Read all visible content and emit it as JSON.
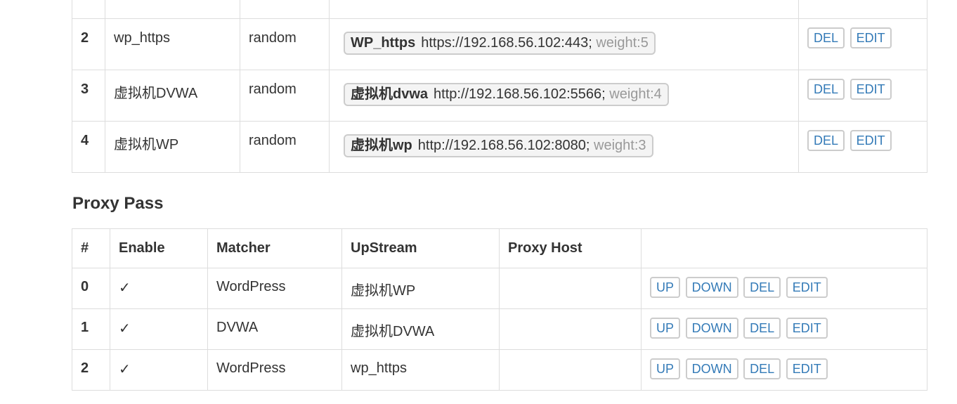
{
  "upstream": {
    "rows": [
      {
        "num": "2",
        "name": "wp_https",
        "algo": "random",
        "server": {
          "name": "WP_https",
          "url": "https://192.168.56.102:443;",
          "weight": "weight:5"
        }
      },
      {
        "num": "3",
        "name": "虚拟机DVWA",
        "algo": "random",
        "server": {
          "name": "虚拟机dvwa",
          "url": "http://192.168.56.102:5566;",
          "weight": "weight:4"
        }
      },
      {
        "num": "4",
        "name": "虚拟机WP",
        "algo": "random",
        "server": {
          "name": "虚拟机wp",
          "url": "http://192.168.56.102:8080;",
          "weight": "weight:3"
        }
      }
    ],
    "actions": {
      "del": "DEL",
      "edit": "EDIT"
    }
  },
  "proxy_pass": {
    "title": "Proxy Pass",
    "headers": [
      "#",
      "Enable",
      "Matcher",
      "UpStream",
      "Proxy Host",
      ""
    ],
    "rows": [
      {
        "num": "0",
        "enable": "✓",
        "matcher": "WordPress",
        "upstream": "虚拟机WP",
        "proxy_host": ""
      },
      {
        "num": "1",
        "enable": "✓",
        "matcher": "DVWA",
        "upstream": "虚拟机DVWA",
        "proxy_host": ""
      },
      {
        "num": "2",
        "enable": "✓",
        "matcher": "WordPress",
        "upstream": "wp_https",
        "proxy_host": ""
      }
    ],
    "actions": {
      "up": "UP",
      "down": "DOWN",
      "del": "DEL",
      "edit": "EDIT"
    }
  }
}
